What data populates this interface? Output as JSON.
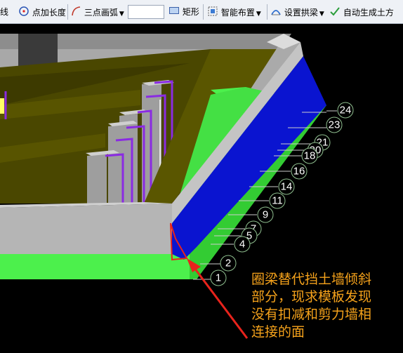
{
  "toolbar": {
    "items": [
      {
        "label": "直线",
        "icon": "line-icon"
      },
      {
        "label": "点加长度",
        "icon": "point-length-icon"
      },
      {
        "label": "三点画弧",
        "icon": "three-point-arc-icon"
      },
      {
        "label": "矩形",
        "icon": "rectangle-icon"
      },
      {
        "label": "智能布置",
        "icon": "smart-layout-icon"
      },
      {
        "label": "设置拱梁",
        "icon": "arch-beam-icon"
      },
      {
        "label": "自动生成土方",
        "icon": "auto-earthwork-icon"
      }
    ],
    "combo_value": ""
  },
  "axis_labels": [
    "24",
    "23",
    "21",
    "20",
    "18",
    "16",
    "14",
    "11",
    "9",
    "7",
    "5",
    "4",
    "2",
    "1"
  ],
  "annotation": {
    "lines": [
      "圈梁替代挡土墙倾斜",
      "部分，现求模板发现",
      "没有扣减和剪力墙相",
      "连接的面"
    ]
  },
  "colors": {
    "beam": "#0a14d0",
    "base": "#4cf04c",
    "wall_top": "#9a9a9a",
    "wall_side": "#b5b5b5",
    "slab": "#4a4700",
    "rebar": "#8a2be2",
    "callout": "#e8231c",
    "annotation_text": "#f5a21b"
  }
}
